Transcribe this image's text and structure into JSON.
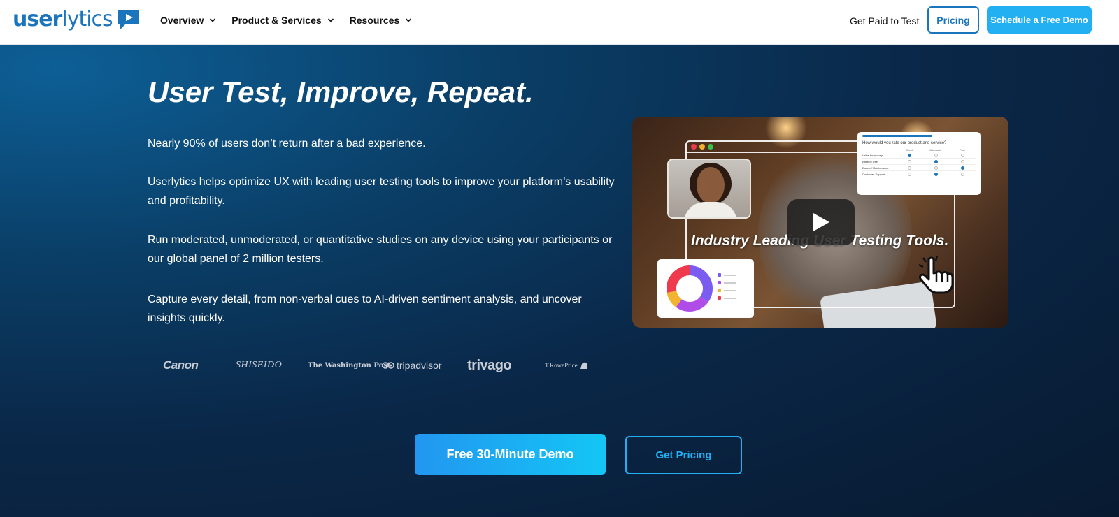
{
  "nav": {
    "logo_part1": "user",
    "logo_part2": "lytics",
    "menu": [
      {
        "label": "Overview"
      },
      {
        "label": "Product & Services"
      },
      {
        "label": "Resources"
      }
    ],
    "get_paid_label": "Get Paid to Test",
    "pricing_label": "Pricing",
    "demo_label": "Schedule a Free Demo"
  },
  "hero": {
    "title": "User Test, Improve, Repeat.",
    "paragraphs": [
      "Nearly 90% of users don’t return after a bad experience.",
      "Userlytics helps optimize UX with leading user testing tools to improve your platform’s usability and profitability.",
      "Run moderated, unmoderated, or quantitative studies on any device using your participants or our global panel of 2 million testers.",
      "Capture every detail, from non-verbal cues to AI-driven sentiment analysis, and uncover insights quickly."
    ],
    "logos": [
      "Canon",
      "SHISEIDO",
      "The Washington Post",
      "tripadvisor",
      "trivago",
      "T.RowePrice"
    ]
  },
  "video": {
    "caption": "Industry Leading User Testing Tools.",
    "survey_question": "How would you rate our product and service?",
    "survey_columns": [
      "Good",
      "Adequate",
      "Poor"
    ],
    "survey_rows": [
      "Value for money",
      "Ease of Use",
      "Ease of Maintenance",
      "Customer Support"
    ],
    "survey_selected": [
      0,
      1,
      2,
      1
    ],
    "donut_colors": [
      "#7b5cf0",
      "#b04de8",
      "#f2b331",
      "#ef3a4e"
    ],
    "donut_fractions": [
      0.35,
      0.25,
      0.12,
      0.28
    ],
    "play_icon": "play-icon",
    "hand_icon": "pointer-hand-icon"
  },
  "cta": {
    "primary_label": "Free 30-Minute Demo",
    "secondary_label": "Get Pricing"
  },
  "colors": {
    "brand": "#1b75bc",
    "accent": "#22b0f2"
  }
}
